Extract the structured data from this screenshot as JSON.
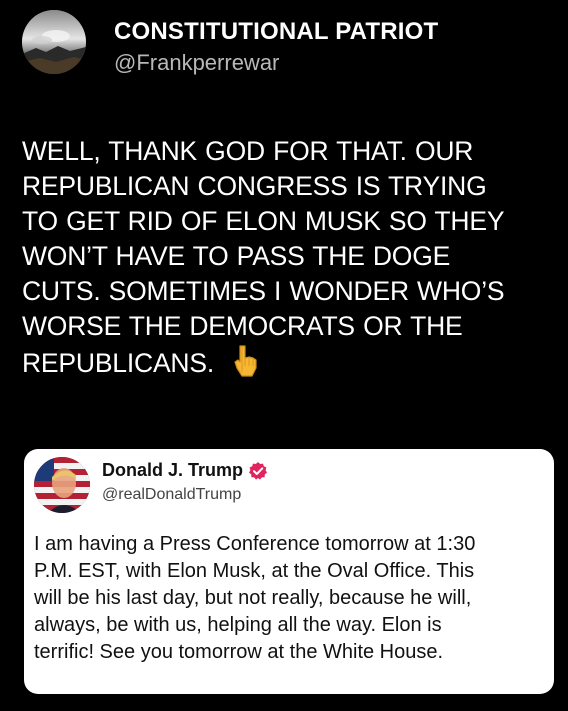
{
  "post": {
    "author_name": "CONSTITUTIONAL PATRIOT",
    "author_handle": "@Frankperrewar",
    "avatar_icon": "landscape-avatar",
    "body_lines": [
      "WELL, THANK GOD FOR THAT. OUR",
      "REPUBLICAN CONGRESS IS TRYING",
      "TO GET RID OF ELON MUSK SO THEY",
      "WON’T HAVE TO PASS THE DOGE",
      "CUTS.  SOMETIMES I WONDER WHO’S",
      "WORSE THE DEMOCRATS OR THE",
      "REPUBLICANS."
    ],
    "emoji": "👇",
    "emoji_icon": "pointing-down-emoji"
  },
  "quote": {
    "author_name": "Donald J. Trump",
    "author_handle": "@realDonaldTrump",
    "verified_icon": "verified-badge-icon",
    "verified_color": "#e0245e",
    "text_lines": [
      "I am having a Press Conference tomorrow at 1:30",
      "P.M. EST, with Elon Musk, at the Oval Office. This",
      "will be his last day, but not really, because he will,",
      "always, be with us, helping all the way. Elon is",
      "terrific! See you tomorrow at the White House."
    ]
  },
  "colors": {
    "background": "#000000",
    "text": "#ffffff",
    "handle": "#b8b8b8",
    "card_background": "#ffffff"
  }
}
